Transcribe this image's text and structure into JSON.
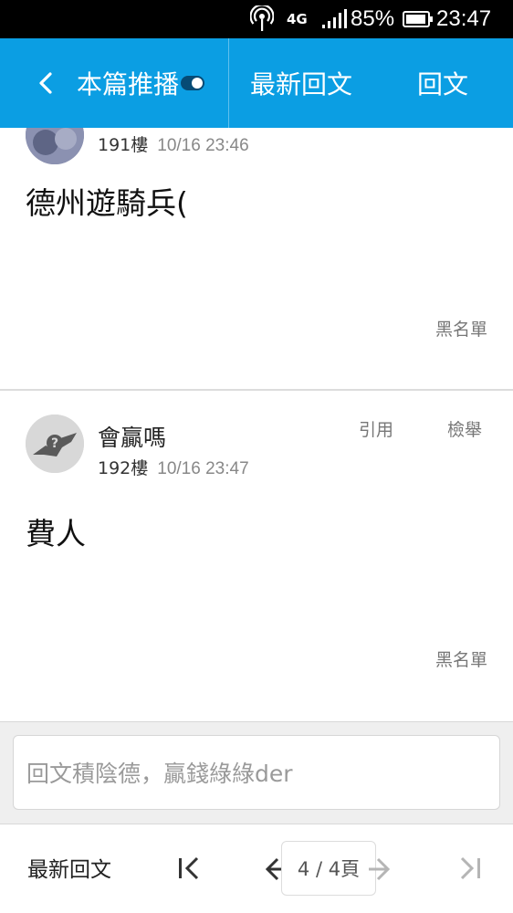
{
  "status_bar": {
    "network": "4G",
    "battery_percent": "85%",
    "time": "23:47",
    "icons": [
      "hotspot-icon",
      "signal-icon",
      "battery-icon"
    ]
  },
  "header": {
    "back_icon": "chevron-left-icon",
    "push_label": "本篇推播",
    "push_toggle_on": true,
    "latest_label": "最新回文",
    "reply_label": "回文",
    "color": "#0b9ee3"
  },
  "posts": [
    {
      "floor": "191樓",
      "time": "10/16 23:46",
      "body": "德州遊騎兵(",
      "blacklist_label": "黑名單"
    },
    {
      "author": "會贏嗎",
      "floor": "192樓",
      "time": "10/16 23:47",
      "quote_label": "引用",
      "report_label": "檢舉",
      "body": "費人",
      "blacklist_label": "黑名單"
    }
  ],
  "composer": {
    "placeholder": "回文積陰德，贏錢綠綠der"
  },
  "bottom_nav": {
    "latest_label": "最新回文",
    "page_indicator": "4 / 4頁",
    "icons": [
      "first-page-icon",
      "prev-page-icon",
      "next-page-icon",
      "last-page-icon"
    ]
  }
}
